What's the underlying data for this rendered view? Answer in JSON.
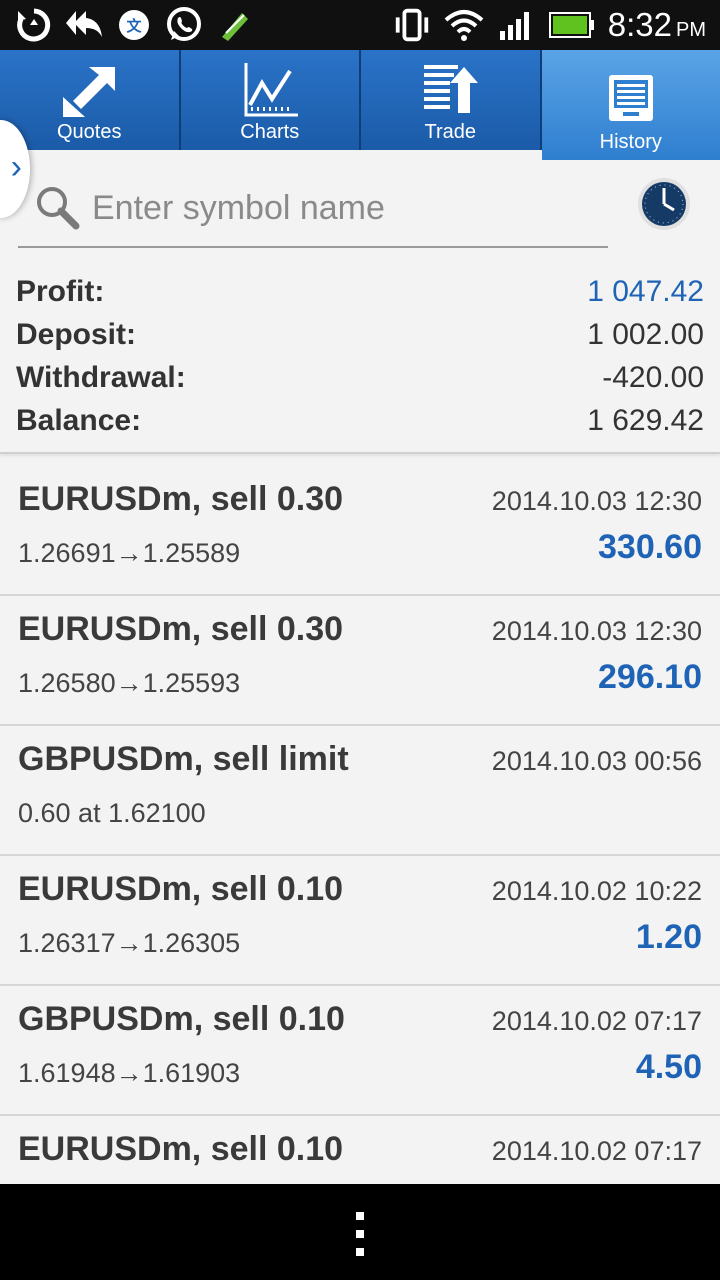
{
  "status_bar": {
    "time": "8:32",
    "ampm": "PM",
    "icons": [
      "sync-icon",
      "reply-all-icon",
      "translate-icon",
      "whatsapp-icon",
      "pen-icon",
      "vibrate-icon",
      "wifi-icon",
      "signal-icon",
      "battery-icon"
    ]
  },
  "tabs": [
    {
      "label": "Quotes",
      "icon": "quotes-icon"
    },
    {
      "label": "Charts",
      "icon": "chart-icon"
    },
    {
      "label": "Trade",
      "icon": "trade-icon"
    },
    {
      "label": "History",
      "icon": "history-icon",
      "active": true
    }
  ],
  "search": {
    "placeholder": "Enter symbol name",
    "value": ""
  },
  "summary": {
    "profit_label": "Profit:",
    "profit_value": "1 047.42",
    "deposit_label": "Deposit:",
    "deposit_value": "1 002.00",
    "withdrawal_label": "Withdrawal:",
    "withdrawal_value": "-420.00",
    "balance_label": "Balance:",
    "balance_value": "1 629.42"
  },
  "history": [
    {
      "symbol": "EURUSDm, sell 0.30",
      "time": "2014.10.03 12:30",
      "detail": "1.26691→1.25589",
      "profit": "330.60"
    },
    {
      "symbol": "EURUSDm, sell 0.30",
      "time": "2014.10.03 12:30",
      "detail": "1.26580→1.25593",
      "profit": "296.10"
    },
    {
      "symbol": "GBPUSDm, sell limit",
      "time": "2014.10.03 00:56",
      "detail": "0.60 at 1.62100",
      "profit": ""
    },
    {
      "symbol": "EURUSDm, sell 0.10",
      "time": "2014.10.02 10:22",
      "detail": "1.26317→1.26305",
      "profit": "1.20"
    },
    {
      "symbol": "GBPUSDm, sell 0.10",
      "time": "2014.10.02 07:17",
      "detail": "1.61948→1.61903",
      "profit": "4.50"
    },
    {
      "symbol": "EURUSDm, sell 0.10",
      "time": "2014.10.02 07:17",
      "detail": "",
      "profit": ""
    }
  ],
  "colors": {
    "accent": "#1e63b5",
    "tab_bar": "#1e63b5",
    "tab_active": "#4b97df"
  }
}
